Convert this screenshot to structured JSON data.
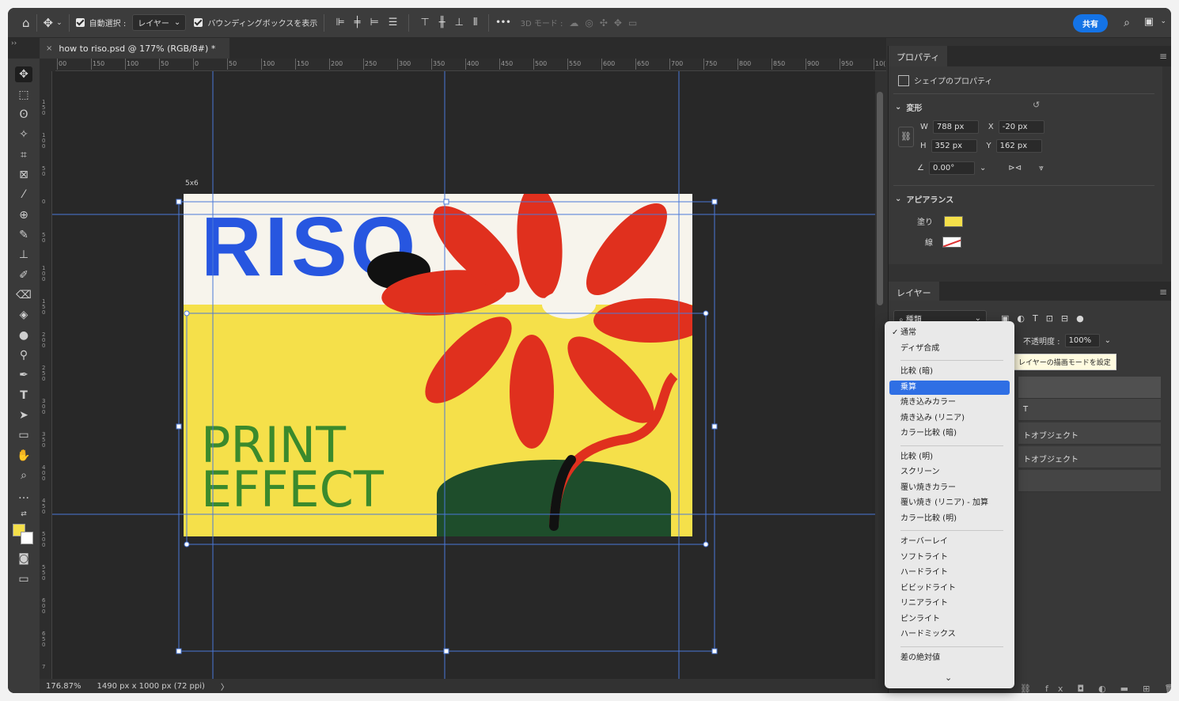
{
  "optbar": {
    "auto_select_label": "自動選択 :",
    "auto_select_value": "レイヤー",
    "show_bbox_label": "バウンディングボックスを表示",
    "mode3d_label": "3D モード :",
    "more_label": "•••",
    "share_label": "共有"
  },
  "document_tab": {
    "title": "how to riso.psd @ 177% (RGB/8#) *",
    "close": "×"
  },
  "ruler": {
    "h_ticks": [
      "00",
      "150",
      "100",
      "50",
      "0",
      "50",
      "100",
      "150",
      "200",
      "250",
      "300",
      "350",
      "400",
      "450",
      "500",
      "550",
      "600",
      "650",
      "700",
      "750",
      "800",
      "850",
      "900",
      "950",
      "10("
    ],
    "v_ticks": [
      "150",
      "100",
      "50",
      "0",
      "50",
      "100",
      "150",
      "200",
      "250",
      "300",
      "350",
      "400",
      "450",
      "500",
      "550",
      "600",
      "650",
      "7"
    ]
  },
  "artboard": {
    "label": "5x6",
    "riso_text": "RISO",
    "print_line1": "PRINT",
    "print_line2": "EFFECT",
    "colors": {
      "top": "#f7f4ec",
      "bottom": "#f5e04a",
      "blue": "#2756e0",
      "red": "#e0301e",
      "green": "#3b8a2c",
      "hill": "#1e4d2b"
    }
  },
  "status": {
    "zoom": "176.87%",
    "doc_size": "1490 px x 1000 px (72 ppi)",
    "arrow": "〉"
  },
  "properties": {
    "tab": "プロパティ",
    "shape_props": "シェイプのプロパティ",
    "transform_section": "変形",
    "w_label": "W",
    "w_value": "788 px",
    "h_label": "H",
    "h_value": "352 px",
    "x_label": "X",
    "x_value": "-20 px",
    "y_label": "Y",
    "y_value": "162 px",
    "angle_value": "0.00°",
    "appearance_section": "アピアランス",
    "fill_label": "塗り",
    "stroke_label": "線"
  },
  "layers": {
    "tab": "レイヤー",
    "filter_value": "種類",
    "opacity_label": "不透明度 :",
    "opacity_value": "100%",
    "tooltip": "レイヤーの描画モードを設定",
    "rows": [
      "",
      "T",
      "トオブジェクト",
      "トオブジェクト"
    ]
  },
  "blend_menu": {
    "items": [
      {
        "label": "通常",
        "checked": true
      },
      {
        "label": "ディザ合成"
      },
      {
        "label": "比較 (暗)"
      },
      {
        "label": "乗算",
        "selected": true
      },
      {
        "label": "焼き込みカラー"
      },
      {
        "label": "焼き込み (リニア)"
      },
      {
        "label": "カラー比較 (暗)"
      },
      {
        "label": "比較 (明)"
      },
      {
        "label": "スクリーン"
      },
      {
        "label": "覆い焼きカラー"
      },
      {
        "label": "覆い焼き (リニア) - 加算"
      },
      {
        "label": "カラー比較 (明)"
      },
      {
        "label": "オーバーレイ"
      },
      {
        "label": "ソフトライト"
      },
      {
        "label": "ハードライト"
      },
      {
        "label": "ビビッドライト"
      },
      {
        "label": "リニアライト"
      },
      {
        "label": "ピンライト"
      },
      {
        "label": "ハードミックス"
      },
      {
        "label": "差の絶対値"
      }
    ],
    "more": "⌄"
  }
}
